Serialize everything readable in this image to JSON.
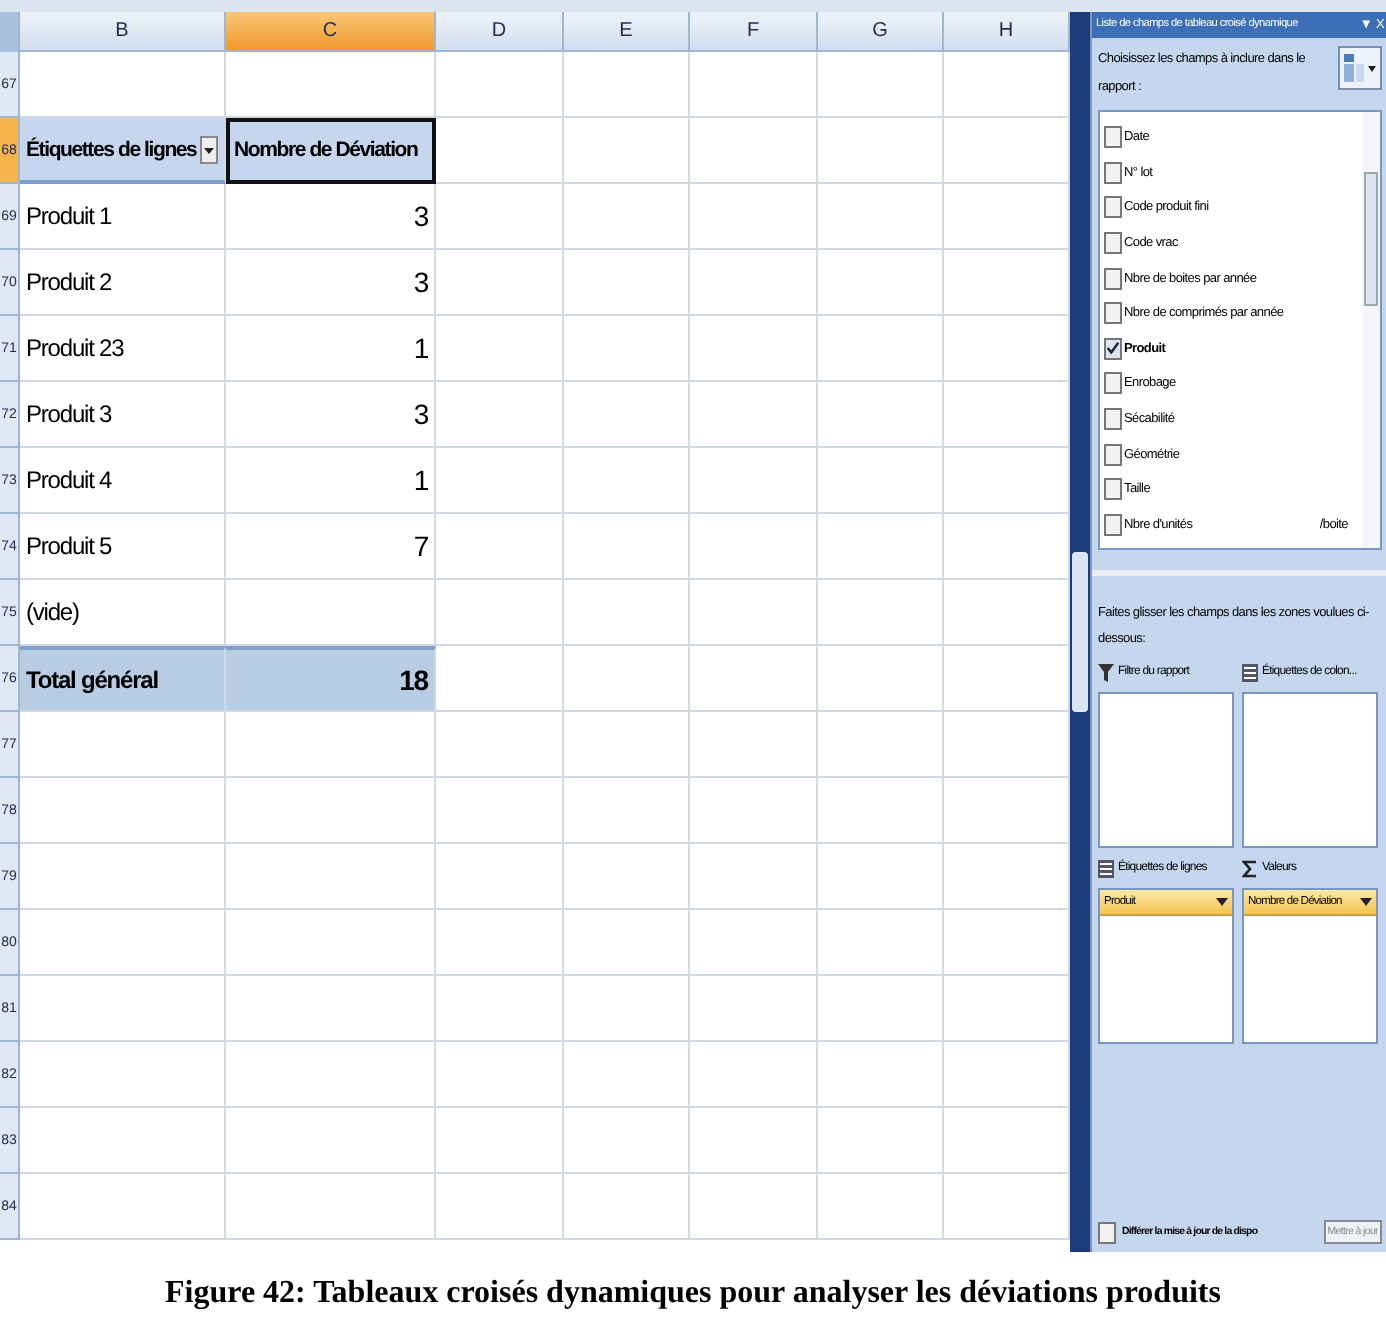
{
  "sheet": {
    "columns": [
      {
        "label": "B",
        "selected": false
      },
      {
        "label": "C",
        "selected": true
      },
      {
        "label": "D",
        "selected": false
      },
      {
        "label": "E",
        "selected": false
      },
      {
        "label": "F",
        "selected": false
      },
      {
        "label": "G",
        "selected": false
      },
      {
        "label": "H",
        "selected": false
      }
    ],
    "rows": [
      {
        "number": "67",
        "selected": false,
        "kind": "empty"
      },
      {
        "number": "68",
        "selected": true,
        "kind": "header",
        "label": "Étiquettes de lignes",
        "value": "Nombre de Déviation"
      },
      {
        "number": "69",
        "selected": false,
        "kind": "item",
        "label": "Produit 1",
        "value": "3"
      },
      {
        "number": "70",
        "selected": false,
        "kind": "item",
        "label": "Produit 2",
        "value": "3"
      },
      {
        "number": "71",
        "selected": false,
        "kind": "item",
        "label": "Produit 23",
        "value": "1"
      },
      {
        "number": "72",
        "selected": false,
        "kind": "item",
        "label": "Produit 3",
        "value": "3"
      },
      {
        "number": "73",
        "selected": false,
        "kind": "item",
        "label": "Produit 4",
        "value": "1"
      },
      {
        "number": "74",
        "selected": false,
        "kind": "item",
        "label": "Produit 5",
        "value": "7"
      },
      {
        "number": "75",
        "selected": false,
        "kind": "item",
        "label": "(vide)"
      },
      {
        "number": "76",
        "selected": false,
        "kind": "total",
        "label": "Total général",
        "value": "18"
      },
      {
        "number": "77",
        "selected": false,
        "kind": "empty"
      },
      {
        "number": "78",
        "selected": false,
        "kind": "empty"
      },
      {
        "number": "79",
        "selected": false,
        "kind": "empty"
      },
      {
        "number": "80",
        "selected": false,
        "kind": "empty"
      },
      {
        "number": "81",
        "selected": false,
        "kind": "empty"
      },
      {
        "number": "82",
        "selected": false,
        "kind": "empty"
      },
      {
        "number": "83",
        "selected": false,
        "kind": "empty"
      },
      {
        "number": "84",
        "selected": false,
        "kind": "empty"
      }
    ]
  },
  "field_list": {
    "title": "Liste de champs de tableau croisé dynamique",
    "menu_glyph": "▼",
    "close_glyph": "X",
    "instruction": "Choisissez les champs à inclure dans le rapport :",
    "fields": [
      {
        "label": "Date",
        "checked": false
      },
      {
        "label": "N° lot",
        "checked": false
      },
      {
        "label": "Code produit fini",
        "checked": false
      },
      {
        "label": "Code vrac",
        "checked": false
      },
      {
        "label": "Nbre de boites par année",
        "checked": false
      },
      {
        "label": "Nbre de comprimés par année",
        "checked": false
      },
      {
        "label": "Produit",
        "checked": true
      },
      {
        "label": "Enrobage",
        "checked": false
      },
      {
        "label": "Sécabilité",
        "checked": false
      },
      {
        "label": "Géométrie",
        "checked": false
      },
      {
        "label": "Taille",
        "checked": false
      },
      {
        "label": "Nbre d'unités",
        "suffix": "/boite",
        "checked": false
      }
    ],
    "drag_instruction": "Faites glisser les champs dans les zones voulues ci-dessous:",
    "zones": [
      {
        "kind": "filter",
        "label": "Filtre du rapport"
      },
      {
        "kind": "columns",
        "label": "Étiquettes de colon..."
      },
      {
        "kind": "rows",
        "label": "Étiquettes de lignes",
        "chips": [
          "Produit"
        ]
      },
      {
        "kind": "values",
        "label": "Valeurs",
        "chips": [
          "Nombre de Déviation"
        ]
      }
    ],
    "defer": {
      "label": "Différer la mise à jour de la dispo",
      "checked": false
    },
    "update_button": {
      "label": "Mettre à jour",
      "disabled": true
    }
  },
  "caption": "Figure 42: Tableaux croisés dynamiques pour analyser les déviations produits"
}
